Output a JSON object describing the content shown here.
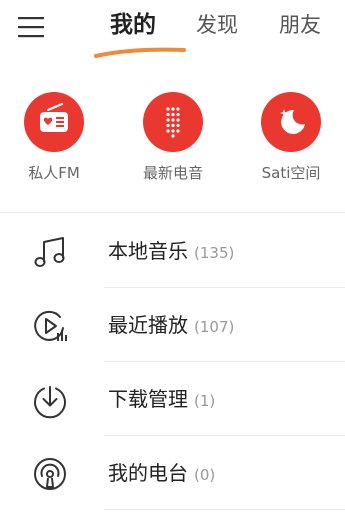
{
  "header": {
    "menu_icon": "menu-icon",
    "tabs": [
      {
        "label": "我的",
        "active": true
      },
      {
        "label": "发现",
        "active": false
      },
      {
        "label": "朋友",
        "active": false
      }
    ],
    "underline_color": "#f08a3a"
  },
  "quick_entries": [
    {
      "label": "私人FM",
      "icon": "radio-icon"
    },
    {
      "label": "最新电音",
      "icon": "speaker-dots-icon"
    },
    {
      "label": "Sati空间",
      "icon": "moon-star-icon"
    }
  ],
  "list": [
    {
      "title": "本地音乐",
      "count": "(135)",
      "icon": "music-note-icon"
    },
    {
      "title": "最近播放",
      "count": "(107)",
      "icon": "recent-play-icon"
    },
    {
      "title": "下载管理",
      "count": "(1)",
      "icon": "download-icon"
    },
    {
      "title": "我的电台",
      "count": "(0)",
      "icon": "podcast-icon"
    }
  ],
  "colors": {
    "accent_red": "#e8382f",
    "text_primary": "#222222",
    "text_secondary": "#999999"
  }
}
